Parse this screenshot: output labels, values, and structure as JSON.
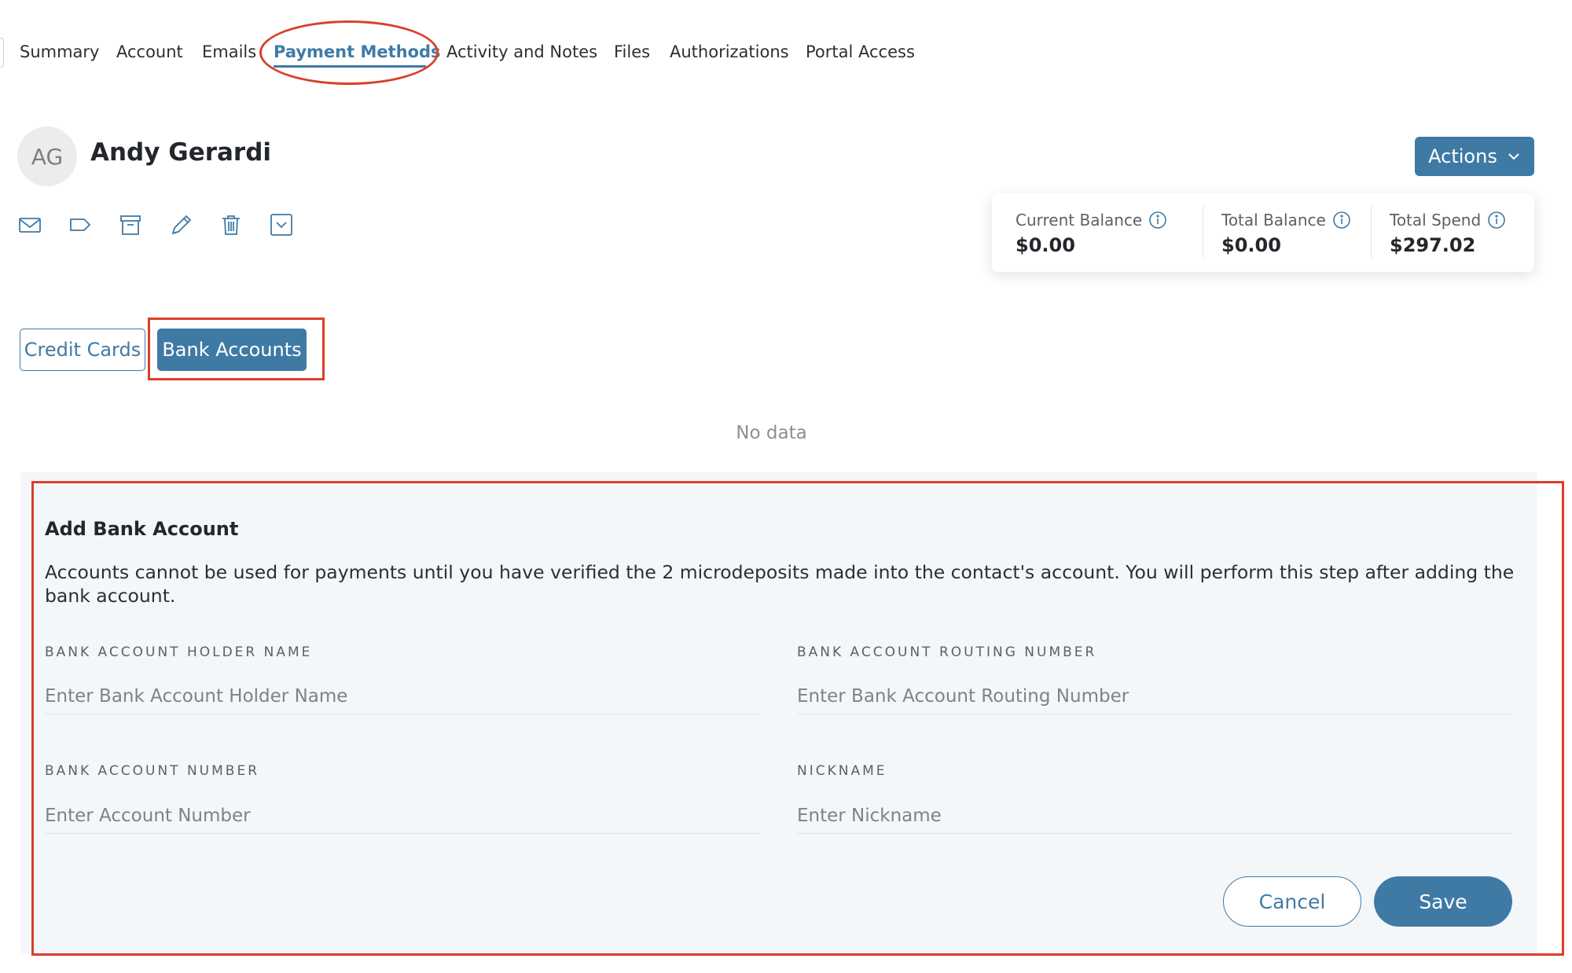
{
  "tabs": [
    {
      "label": "Summary"
    },
    {
      "label": "Account"
    },
    {
      "label": "Emails"
    },
    {
      "label": "Payment Methods",
      "active": true
    },
    {
      "label": "Activity and Notes"
    },
    {
      "label": "Files"
    },
    {
      "label": "Authorizations"
    },
    {
      "label": "Portal Access"
    }
  ],
  "contact": {
    "initials": "AG",
    "name": "Andy Gerardi"
  },
  "toolbar_icons": [
    "mail-icon",
    "tag-icon",
    "archive-icon",
    "pencil-icon",
    "trash-icon",
    "dropdown-box-icon"
  ],
  "actions": {
    "label": "Actions"
  },
  "balances": [
    {
      "label": "Current Balance",
      "value": "$0.00"
    },
    {
      "label": "Total Balance",
      "value": "$0.00"
    },
    {
      "label": "Total Spend",
      "value": "$297.02"
    }
  ],
  "payment_toggle": {
    "credit_cards": "Credit Cards",
    "bank_accounts": "Bank Accounts",
    "selected": "Bank Accounts"
  },
  "empty_state": "No data",
  "form": {
    "title": "Add Bank Account",
    "description": "Accounts cannot be used for payments until you have verified the 2 microdeposits made into the contact's account. You will perform this step after adding the bank account.",
    "fields": {
      "holder_name": {
        "label": "BANK ACCOUNT HOLDER NAME",
        "placeholder": "Enter Bank Account Holder Name",
        "value": ""
      },
      "routing_number": {
        "label": "BANK ACCOUNT ROUTING NUMBER",
        "placeholder": "Enter Bank Account Routing Number",
        "value": ""
      },
      "account_number": {
        "label": "BANK ACCOUNT NUMBER",
        "placeholder": "Enter Account Number",
        "value": ""
      },
      "nickname": {
        "label": "NICKNAME",
        "placeholder": "Enter Nickname",
        "value": ""
      }
    },
    "cancel_label": "Cancel",
    "save_label": "Save"
  },
  "colors": {
    "accent": "#3f7aa5",
    "annotation": "#d9402b",
    "panel_bg": "#f4f7fa"
  }
}
